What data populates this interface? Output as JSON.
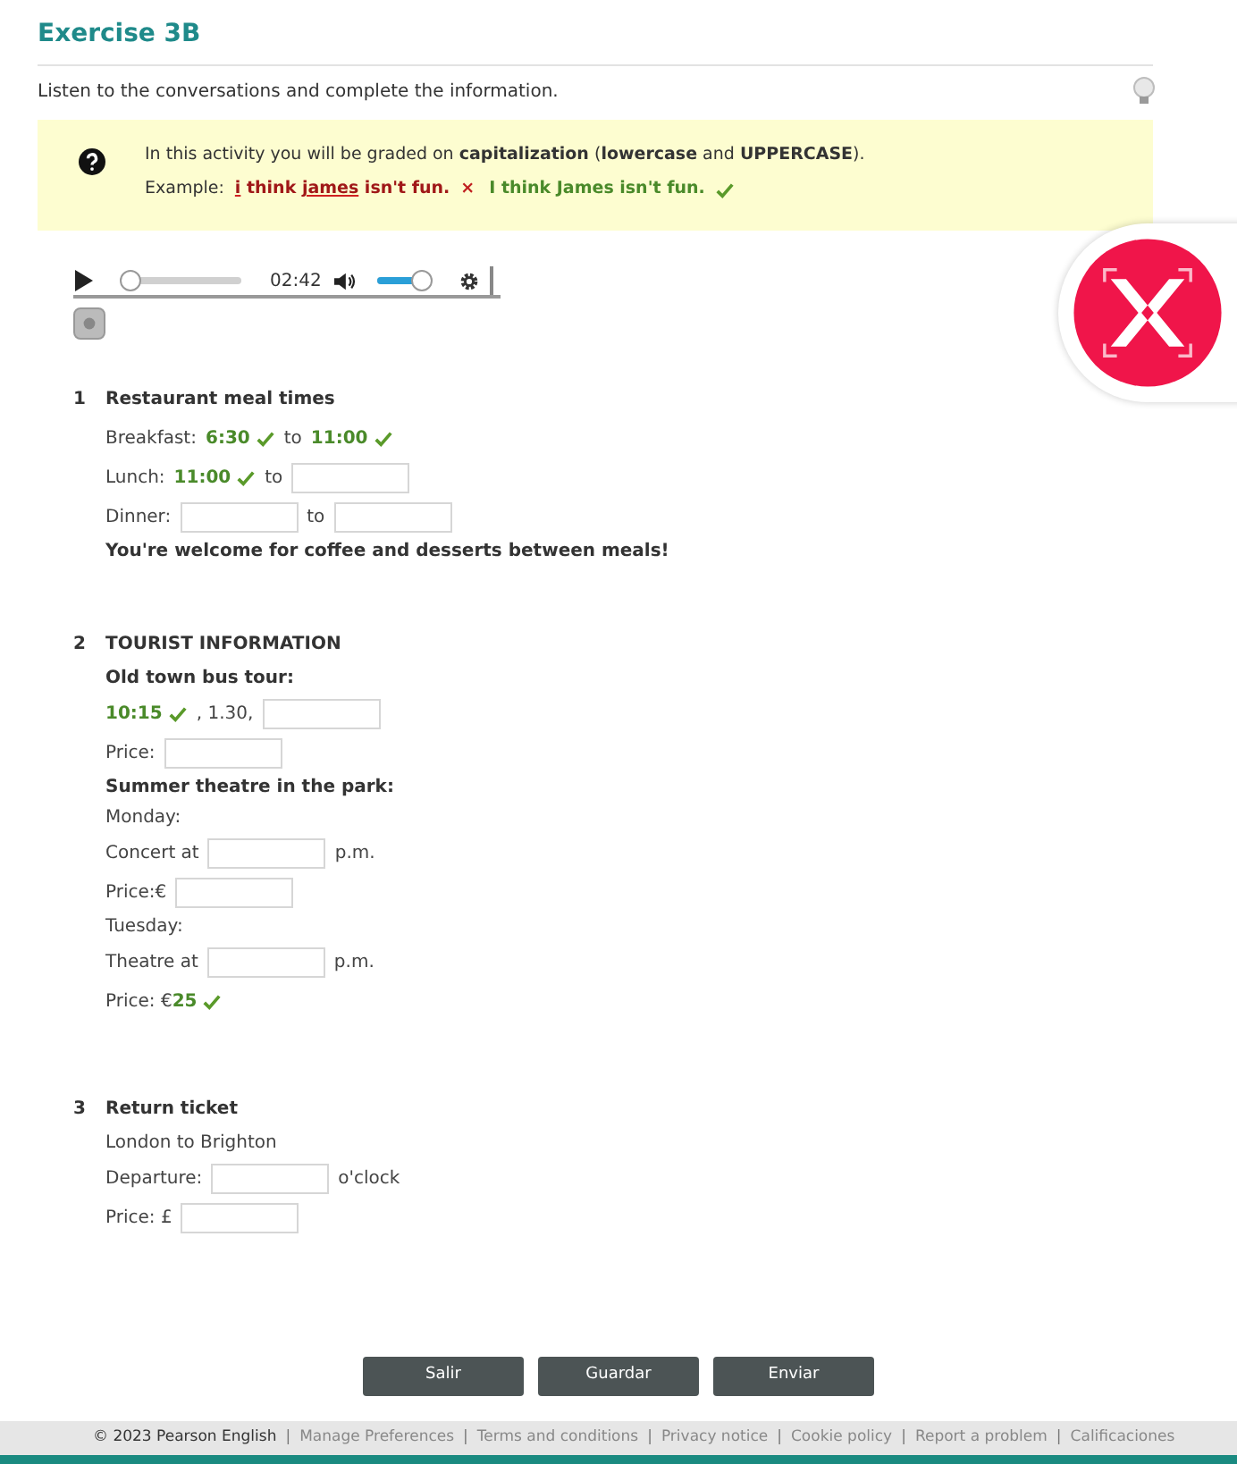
{
  "title": "Exercise 3B",
  "instruction": "Listen to the conversations and complete the information.",
  "notice": {
    "text": "In this activity you will be graded on **capitalization** (**lowercase** and **UPPERCASE**).",
    "example_label": "Example:",
    "wrong": [
      {
        "text": "i",
        "error": true
      },
      {
        "text": " think ",
        "error": false
      },
      {
        "text": "james",
        "error": true
      },
      {
        "text": " isn't fun.",
        "error": false
      }
    ],
    "wrong_mark": "×",
    "right": "I think James isn't fun."
  },
  "player": {
    "progress": {
      "level": 0
    },
    "time": "02:42",
    "volume": {
      "level": 0.85
    }
  },
  "sections": [
    {
      "number": "1",
      "title": "Restaurant meal times",
      "lines": [
        [
          {
            "kind": "text",
            "text": "Breakfast:"
          },
          {
            "kind": "answer",
            "text": "6:30"
          },
          {
            "kind": "text",
            "text": "to"
          },
          {
            "kind": "answer",
            "text": "11:00"
          }
        ],
        [
          {
            "kind": "text",
            "text": "Lunch:"
          },
          {
            "kind": "answer",
            "text": "11:00"
          },
          {
            "kind": "text",
            "text": "to"
          },
          {
            "kind": "blank"
          }
        ],
        [
          {
            "kind": "text",
            "text": "Dinner:"
          },
          {
            "kind": "blank"
          },
          {
            "kind": "text",
            "text": "to"
          },
          {
            "kind": "blank"
          }
        ],
        [
          {
            "kind": "bold",
            "text": "You're welcome for coffee and desserts between meals!"
          }
        ]
      ]
    },
    {
      "number": "2",
      "title": "TOURIST INFORMATION",
      "lines": [
        [
          {
            "kind": "bold",
            "text": "Old town bus tour:"
          }
        ],
        [
          {
            "kind": "answer",
            "text": "10:15"
          },
          {
            "kind": "text",
            "text": ", 1.30,"
          },
          {
            "kind": "blank"
          }
        ],
        [
          {
            "kind": "text",
            "text": "Price:"
          },
          {
            "kind": "blank"
          }
        ],
        [
          {
            "kind": "bold",
            "text": "Summer theatre in the park:"
          }
        ],
        [
          {
            "kind": "text",
            "text": "Monday:"
          }
        ],
        [
          {
            "kind": "text",
            "text": "Concert at"
          },
          {
            "kind": "blank"
          },
          {
            "kind": "text",
            "text": "p.m."
          }
        ],
        [
          {
            "kind": "text",
            "text": "Price:€"
          },
          {
            "kind": "blank"
          }
        ],
        [
          {
            "kind": "text",
            "text": "Tuesday:"
          }
        ],
        [
          {
            "kind": "text",
            "text": "Theatre at"
          },
          {
            "kind": "blank"
          },
          {
            "kind": "text",
            "text": "p.m."
          }
        ],
        [
          {
            "kind": "text",
            "text": "Price: €"
          },
          {
            "kind": "answer",
            "text": "25"
          }
        ]
      ]
    },
    {
      "number": "3",
      "title": "Return ticket",
      "lines": [
        [
          {
            "kind": "text",
            "text": "London to Brighton"
          }
        ],
        [
          {
            "kind": "text",
            "text": "Departure:"
          },
          {
            "kind": "blank"
          },
          {
            "kind": "text",
            "text": "o'clock"
          }
        ],
        [
          {
            "kind": "text",
            "text": "Price: £"
          },
          {
            "kind": "blank"
          }
        ]
      ]
    }
  ],
  "buttons": [
    "Salir",
    "Guardar",
    "Enviar"
  ],
  "footer": {
    "copyright": "© 2023 Pearson English",
    "separator": "|",
    "links": [
      "Manage Preferences",
      "Terms and conditions",
      "Privacy notice",
      "Cookie policy",
      "Report a problem",
      "Calificaciones"
    ]
  }
}
